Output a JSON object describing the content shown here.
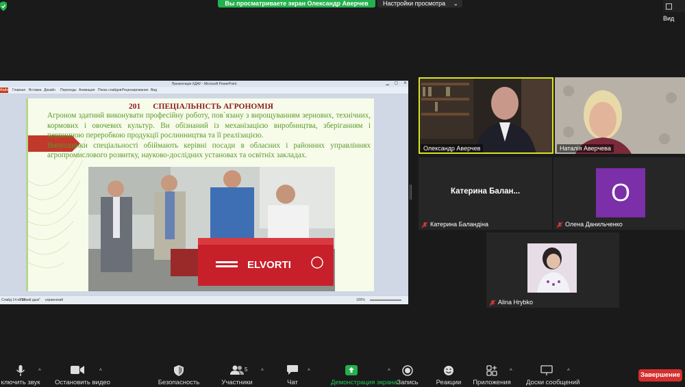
{
  "top": {
    "share_banner": "Вы просматриваете экран Олександр Аверчев",
    "view_settings": "Настройки просмотра",
    "view_button": "Вид"
  },
  "ppt": {
    "window_title": "Презентація ХДАУ - Microsoft PowerPoint",
    "file_tab": "Файл",
    "ribbon_tabs": [
      "Главная",
      "Вставка",
      "Дизайн",
      "Переходы",
      "Анимация",
      "Показ слайдов",
      "Рецензирование",
      "Вид"
    ],
    "slide": {
      "number": "201",
      "heading": "СПЕЦІАЛЬНІСТЬ АГРОНОМІЯ",
      "paragraph1": "Агроном здатний виконувати професійну роботу, пов`язану з вирощуванням зернових, технічних, кормових і овочевих культур. Ви обізнаний із механізацією виробництва, зберіганням і первинною переробкою продукції рослинництва та її реалізацією.",
      "paragraph2": "Випускники спеціальності обіймають керівні посади в обласних і районних управліннях агропромислового розвитку, науково-дослідних установах та освітніх закладах.",
      "photo_brand": "ELVORTI"
    },
    "status": {
      "slide_info": "Слайд 14 из 28",
      "theme": "\"Легкий дым\"",
      "language": "украинский",
      "zoom": "100%"
    }
  },
  "participants": [
    {
      "name": "Олександр Аверчев",
      "muted": false,
      "video": true,
      "active_speaker": true
    },
    {
      "name": "Наталія Аверчева",
      "muted": false,
      "video": true,
      "active_speaker": false
    },
    {
      "name": "Катерина Баландіна",
      "display_short": "Катерина  Балан...",
      "muted": true,
      "video": false
    },
    {
      "name": "Олена Данильченко",
      "avatar_letter": "O",
      "avatar_color": "#7b2fa8",
      "muted": true,
      "video": false
    },
    {
      "name": "Alina Hrybko",
      "muted": true,
      "video": false
    }
  ],
  "toolbar": {
    "mute": "ключить звук",
    "stop_video": "Остановить видео",
    "security": "Безопасность",
    "participants": "Участники",
    "participants_count": "5",
    "chat": "Чат",
    "share_screen": "Демонстрация экрана",
    "record": "Запись",
    "reactions": "Реакции",
    "apps": "Приложения",
    "whiteboards": "Доски сообщений",
    "end": "Завершение"
  },
  "colors": {
    "share_green": "#23b14d",
    "active_speaker_border": "#d9e621",
    "end_red": "#d32f2f",
    "avatar_purple": "#7b2fa8",
    "slide_heading": "#8b1a1a",
    "slide_text": "#5a9a2a"
  }
}
